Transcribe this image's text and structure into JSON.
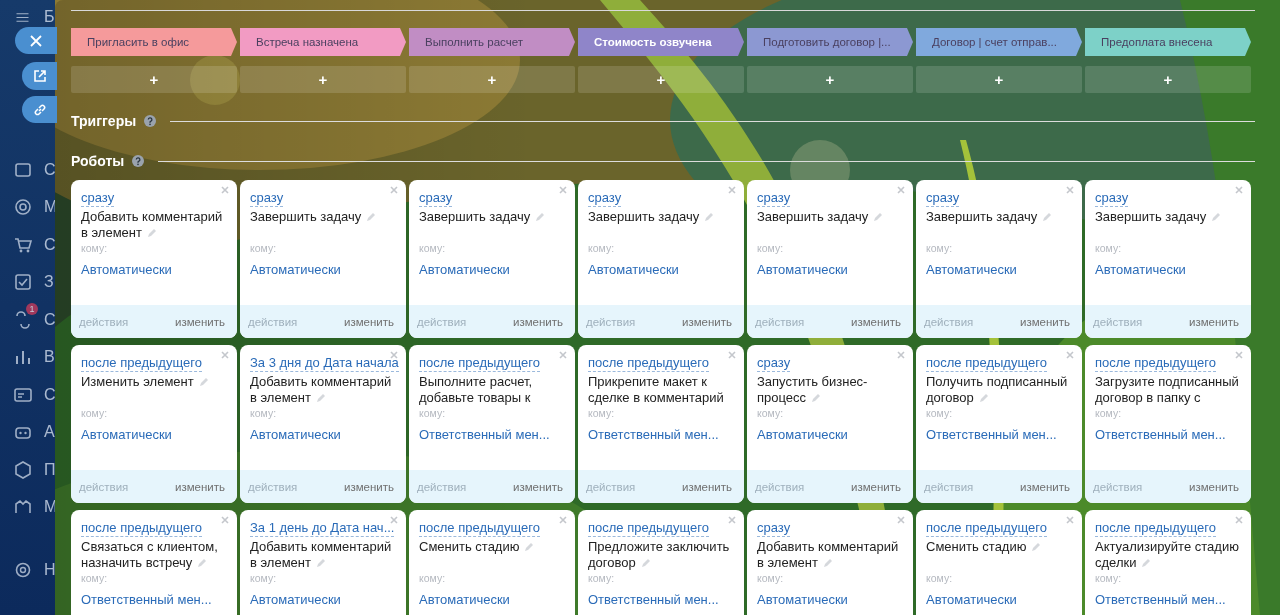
{
  "sidebar": {
    "items": [
      {
        "letter": "Б",
        "kind": "menu"
      },
      {
        "letter": "С",
        "kind": "home"
      },
      {
        "letter": "М",
        "kind": "target"
      },
      {
        "letter": "С",
        "kind": "cart"
      },
      {
        "letter": "З",
        "kind": "check"
      },
      {
        "letter": "С",
        "kind": "flow",
        "badge": "1"
      },
      {
        "letter": "В",
        "kind": "chart"
      },
      {
        "letter": "С",
        "kind": "card"
      },
      {
        "letter": "А",
        "kind": "robot"
      },
      {
        "letter": "П",
        "kind": "cube"
      },
      {
        "letter": "М",
        "kind": "market"
      },
      {
        "letter": "Н",
        "kind": "gear"
      }
    ]
  },
  "side_buttons": [
    {
      "kind": "close"
    },
    {
      "kind": "open"
    },
    {
      "kind": "link"
    }
  ],
  "stages": [
    {
      "title": "Пригласить в офис",
      "color": "#f59a9b",
      "selected": false
    },
    {
      "title": "Встреча назначена",
      "color": "#f29bc3",
      "selected": false
    },
    {
      "title": "Выполнить расчет",
      "color": "#c18dc4",
      "selected": false
    },
    {
      "title": "Стоимость озвучена",
      "color": "#8f85c9",
      "selected": true
    },
    {
      "title": "Подготовить договор |...",
      "color": "#8c98d2",
      "selected": false
    },
    {
      "title": "Договор | счет отправ...",
      "color": "#80a9dd",
      "selected": false
    },
    {
      "title": "Предоплата внесена",
      "color": "#7dd1c8",
      "selected": false
    }
  ],
  "add_buttons": [
    "+",
    "+",
    "+",
    "+",
    "+",
    "+",
    "+"
  ],
  "triggers": {
    "title": "Триггеры"
  },
  "robots": {
    "title": "Роботы",
    "rows": [
      [
        {
          "delay": "сразу",
          "title": "Добавить комментарий в элемент",
          "editable": true,
          "recipient_label": "кому:",
          "recipient": "Автоматически",
          "actions": {
            "label": "действия",
            "disabled": true
          },
          "edit": "изменить"
        },
        {
          "delay": "сразу",
          "title": "Завершить задачу",
          "editable": true,
          "recipient_label": "кому:",
          "recipient": "Автоматически",
          "actions": {
            "label": "действия",
            "disabled": true
          },
          "edit": "изменить"
        },
        {
          "delay": "сразу",
          "title": "Завершить задачу",
          "editable": true,
          "recipient_label": "кому:",
          "recipient": "Автоматически",
          "actions": {
            "label": "действия",
            "disabled": true
          },
          "edit": "изменить"
        },
        {
          "delay": "сразу",
          "title": "Завершить задачу",
          "editable": true,
          "recipient_label": "кому:",
          "recipient": "Автоматически",
          "actions": {
            "label": "действия",
            "disabled": true
          },
          "edit": "изменить"
        },
        {
          "delay": "сразу",
          "title": "Завершить задачу",
          "editable": true,
          "recipient_label": "кому:",
          "recipient": "Автоматически",
          "actions": {
            "label": "действия",
            "disabled": true
          },
          "edit": "изменить"
        },
        {
          "delay": "сразу",
          "title": "Завершить задачу",
          "editable": true,
          "recipient_label": "кому:",
          "recipient": "Автоматически",
          "actions": {
            "label": "действия",
            "disabled": true
          },
          "edit": "изменить"
        },
        {
          "delay": "сразу",
          "title": "Завершить задачу",
          "editable": true,
          "recipient_label": "кому:",
          "recipient": "Автоматически",
          "actions": {
            "label": "действия",
            "disabled": true
          },
          "edit": "изменить"
        }
      ],
      [
        {
          "delay": "после предыдущего",
          "title": "Изменить элемент",
          "editable": true,
          "recipient_label": "кому:",
          "recipient": "Автоматически",
          "actions": {
            "label": "действия",
            "disabled": true
          },
          "edit": "изменить"
        },
        {
          "delay": "За 3 дня до Дата начала",
          "title": "Добавить комментарий в элемент",
          "editable": true,
          "recipient_label": "кому:",
          "recipient": "Автоматически",
          "actions": {
            "label": "действия",
            "disabled": true
          },
          "edit": "изменить"
        },
        {
          "delay": "после предыдущего",
          "title": "Выполните расчет, добавьте товары к",
          "editable": false,
          "recipient_label": "кому:",
          "recipient": "Ответственный мен...",
          "actions": {
            "label": "действия",
            "disabled": true
          },
          "edit": "изменить"
        },
        {
          "delay": "после предыдущего",
          "title": "Прикрепите макет к сделке в комментарий",
          "editable": false,
          "recipient_label": "кому:",
          "recipient": "Ответственный мен...",
          "actions": {
            "label": "действия",
            "disabled": true
          },
          "edit": "изменить"
        },
        {
          "delay": "сразу",
          "title": "Запустить бизнес-процесс",
          "editable": true,
          "recipient_label": "кому:",
          "recipient": "Автоматически",
          "actions": {
            "label": "действия",
            "disabled": true
          },
          "edit": "изменить"
        },
        {
          "delay": "после предыдущего",
          "title": "Получить подписанный договор",
          "editable": true,
          "recipient_label": "кому:",
          "recipient": "Ответственный мен...",
          "actions": {
            "label": "действия",
            "disabled": true
          },
          "edit": "изменить"
        },
        {
          "delay": "после предыдущего",
          "title": "Загрузите подписанный договор в папку с",
          "editable": false,
          "recipient_label": "кому:",
          "recipient": "Ответственный мен...",
          "actions": {
            "label": "действия",
            "disabled": true
          },
          "edit": "изменить"
        }
      ],
      [
        {
          "delay": "после предыдущего",
          "title": "Связаться с клиентом, назначить встречу",
          "editable": true,
          "recipient_label": "кому:",
          "recipient": "Ответственный мен..."
        },
        {
          "delay": "За 1 день до Дата нач...",
          "title": "Добавить комментарий в элемент",
          "editable": true,
          "recipient_label": "кому:",
          "recipient": "Автоматически"
        },
        {
          "delay": "после предыдущего",
          "title": "Сменить стадию",
          "editable": true,
          "recipient_label": "кому:",
          "recipient": "Автоматически"
        },
        {
          "delay": "после предыдущего",
          "title": "Предложите заключить договор",
          "editable": true,
          "recipient_label": "кому:",
          "recipient": "Ответственный мен..."
        },
        {
          "delay": "сразу",
          "title": "Добавить комментарий в элемент",
          "editable": true,
          "recipient_label": "кому:",
          "recipient": "Автоматически"
        },
        {
          "delay": "после предыдущего",
          "title": "Сменить стадию",
          "editable": true,
          "recipient_label": "кому:",
          "recipient": "Автоматически"
        },
        {
          "delay": "после предыдущего",
          "title": "Актуализируйте стадию сделки",
          "editable": true,
          "recipient_label": "кому:",
          "recipient": "Ответственный мен..."
        }
      ]
    ]
  }
}
